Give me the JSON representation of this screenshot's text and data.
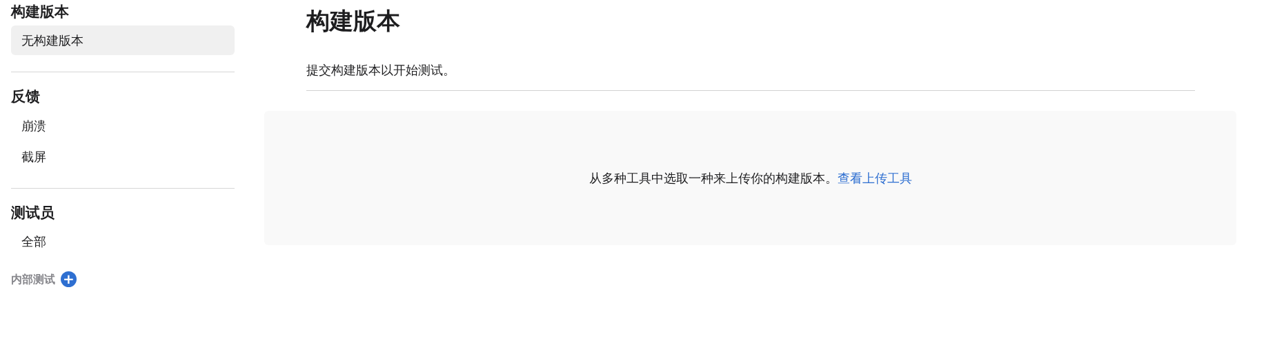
{
  "sidebar": {
    "sections": [
      {
        "title": "构建版本",
        "items": [
          {
            "label": "无构建版本",
            "selected": true
          }
        ]
      },
      {
        "title": "反馈",
        "items": [
          {
            "label": "崩溃",
            "selected": false
          },
          {
            "label": "截屏",
            "selected": false
          }
        ]
      },
      {
        "title": "测试员",
        "items": [
          {
            "label": "全部",
            "selected": false
          }
        ]
      }
    ],
    "group": {
      "label": "内部测试",
      "add_button": "+"
    }
  },
  "main": {
    "title": "构建版本",
    "description": "提交构建版本以开始测试。",
    "empty_state": {
      "text": "从多种工具中选取一种来上传你的构建版本。",
      "link": "查看上传工具"
    }
  }
}
